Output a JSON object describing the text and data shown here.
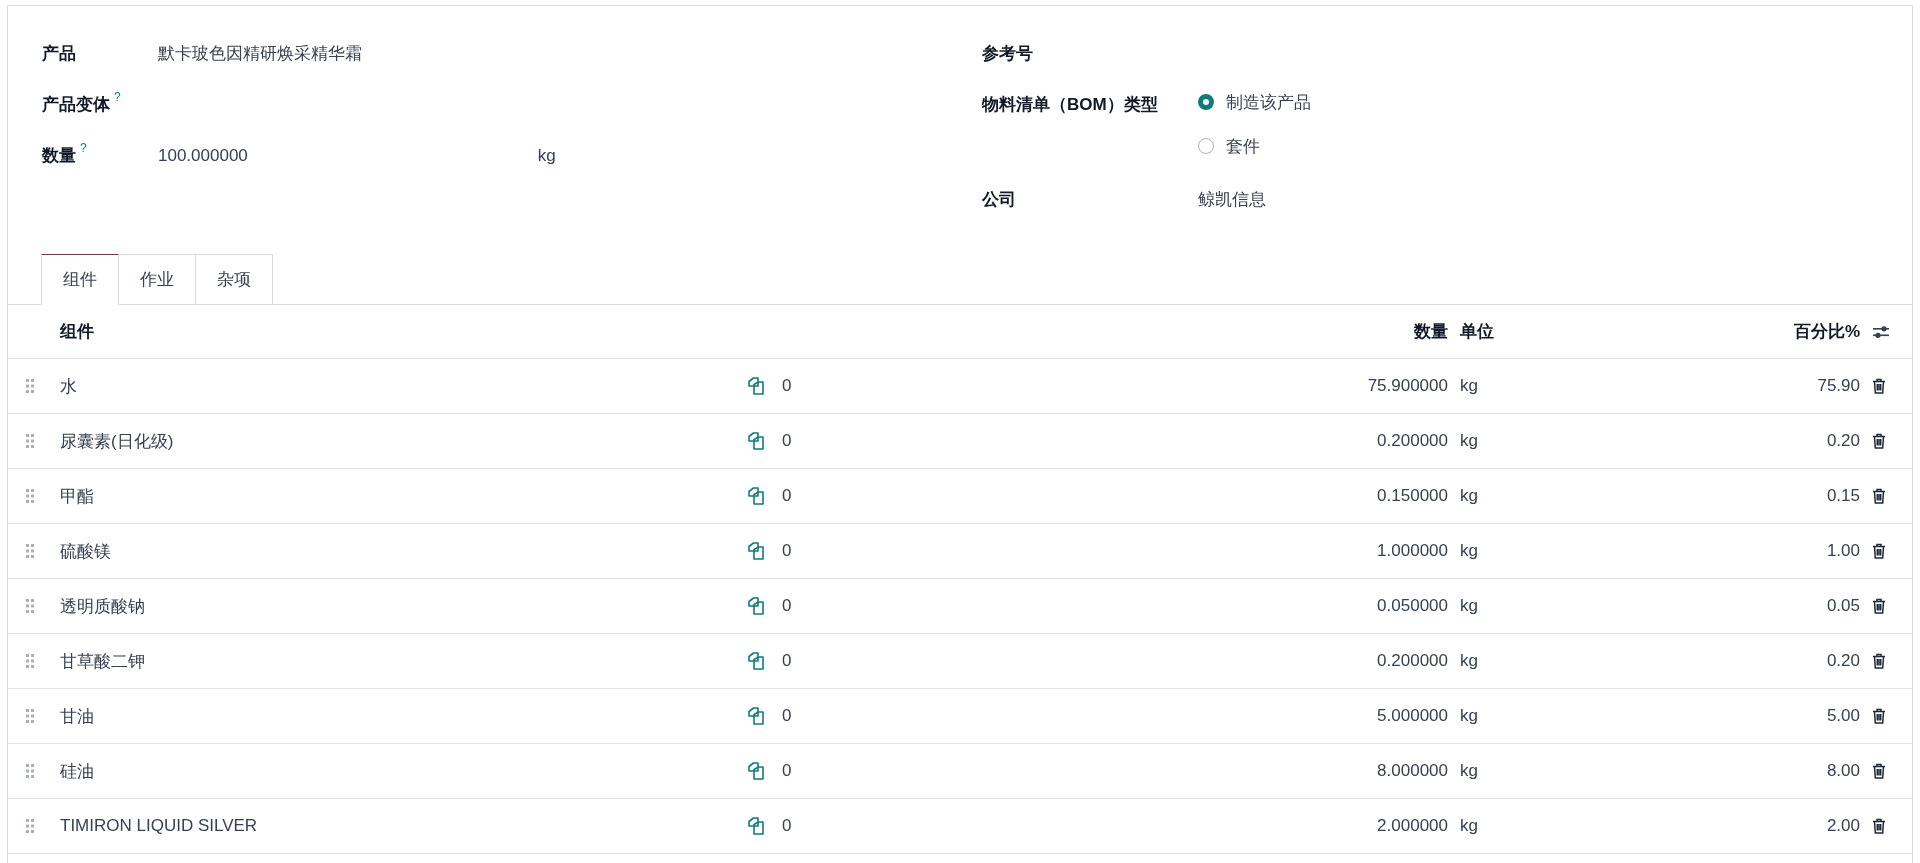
{
  "form": {
    "left": [
      {
        "label": "产品",
        "value": "默卡玻色因精研焕采精华霜"
      },
      {
        "label": "产品变体",
        "help": "?"
      },
      {
        "label": "数量",
        "help": "?",
        "value": "100.000000",
        "unit": "kg"
      }
    ],
    "reference": {
      "label": "参考号"
    },
    "bom_type": {
      "label": "物料清单（BOM）类型",
      "options": [
        {
          "label": "制造该产品",
          "selected": true
        },
        {
          "label": "套件",
          "selected": false
        }
      ]
    },
    "company": {
      "label": "公司",
      "value": "鲸凯信息"
    }
  },
  "tabs": [
    {
      "label": "组件",
      "selected": true
    },
    {
      "label": "作业",
      "selected": false
    },
    {
      "label": "杂项",
      "selected": false
    }
  ],
  "table": {
    "columns": [
      "组件",
      "数量",
      "单位",
      "百分比%"
    ],
    "rows": [
      {
        "component": "水",
        "column_2": "0",
        "quantity": "75.900000",
        "unit": "kg",
        "percent": "75.90"
      },
      {
        "component": "尿囊素(日化级)",
        "column_2": "0",
        "quantity": "0.200000",
        "unit": "kg",
        "percent": "0.20"
      },
      {
        "component": "甲酯",
        "column_2": "0",
        "quantity": "0.150000",
        "unit": "kg",
        "percent": "0.15"
      },
      {
        "component": "硫酸镁",
        "column_2": "0",
        "quantity": "1.000000",
        "unit": "kg",
        "percent": "1.00"
      },
      {
        "component": "透明质酸钠",
        "column_2": "0",
        "quantity": "0.050000",
        "unit": "kg",
        "percent": "0.05"
      },
      {
        "component": "甘草酸二钾",
        "column_2": "0",
        "quantity": "0.200000",
        "unit": "kg",
        "percent": "0.20"
      },
      {
        "component": "甘油",
        "column_2": "0",
        "quantity": "5.000000",
        "unit": "kg",
        "percent": "5.00"
      },
      {
        "component": "硅油",
        "column_2": "0",
        "quantity": "8.000000",
        "unit": "kg",
        "percent": "8.00"
      },
      {
        "component": "TIMIRON LIQUID SILVER",
        "column_2": "0",
        "quantity": "2.000000",
        "unit": "kg",
        "percent": "2.00"
      }
    ]
  }
}
